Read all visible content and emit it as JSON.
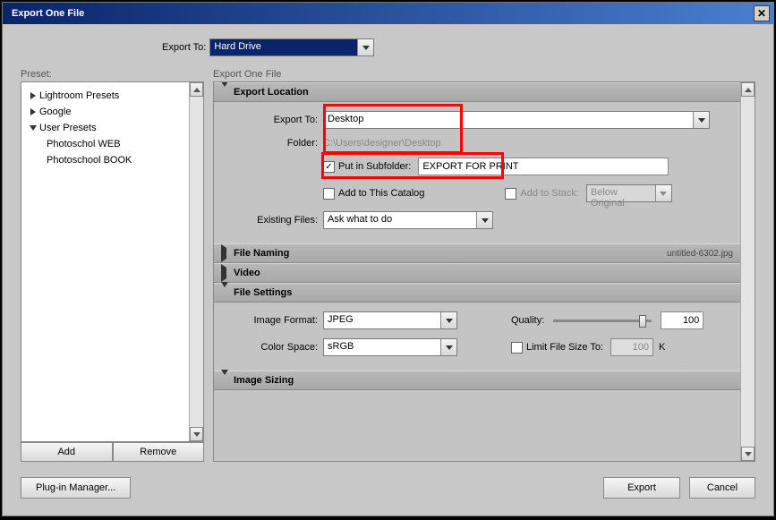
{
  "title": "Export One File",
  "export_to_label": "Export To:",
  "export_to_value": "Hard Drive",
  "preset_label": "Preset:",
  "presets": {
    "items": [
      {
        "label": "Lightroom Presets",
        "expanded": false
      },
      {
        "label": "Google",
        "expanded": false
      },
      {
        "label": "User Presets",
        "expanded": true
      },
      {
        "label": "Photoschol WEB",
        "child": true
      },
      {
        "label": "Photoschool BOOK",
        "child": true
      }
    ]
  },
  "preset_btn_add": "Add",
  "preset_btn_remove": "Remove",
  "right_label": "Export One File",
  "sections": {
    "export_location": {
      "title": "Export Location",
      "export_to_label": "Export To:",
      "export_to_value": "Desktop",
      "folder_label": "Folder:",
      "folder_value": "C:\\Users\\designer\\Desktop",
      "subfolder_chk": "Put in Subfolder:",
      "subfolder_value": "EXPORT FOR PRINT",
      "add_catalog": "Add to This Catalog",
      "add_stack": "Add to Stack:",
      "below_original": "Below Original",
      "existing_label": "Existing Files:",
      "existing_value": "Ask what to do"
    },
    "file_naming": {
      "title": "File Naming",
      "extra": "untitled-6302.jpg"
    },
    "video": {
      "title": "Video"
    },
    "file_settings": {
      "title": "File Settings",
      "format_label": "Image Format:",
      "format_value": "JPEG",
      "quality_label": "Quality:",
      "quality_value": "100",
      "colorspace_label": "Color Space:",
      "colorspace_value": "sRGB",
      "limit_label": "Limit File Size To:",
      "limit_value": "100",
      "limit_unit": "K"
    },
    "image_sizing": {
      "title": "Image Sizing"
    }
  },
  "plugin_mgr": "Plug-in Manager...",
  "export_btn": "Export",
  "cancel_btn": "Cancel"
}
